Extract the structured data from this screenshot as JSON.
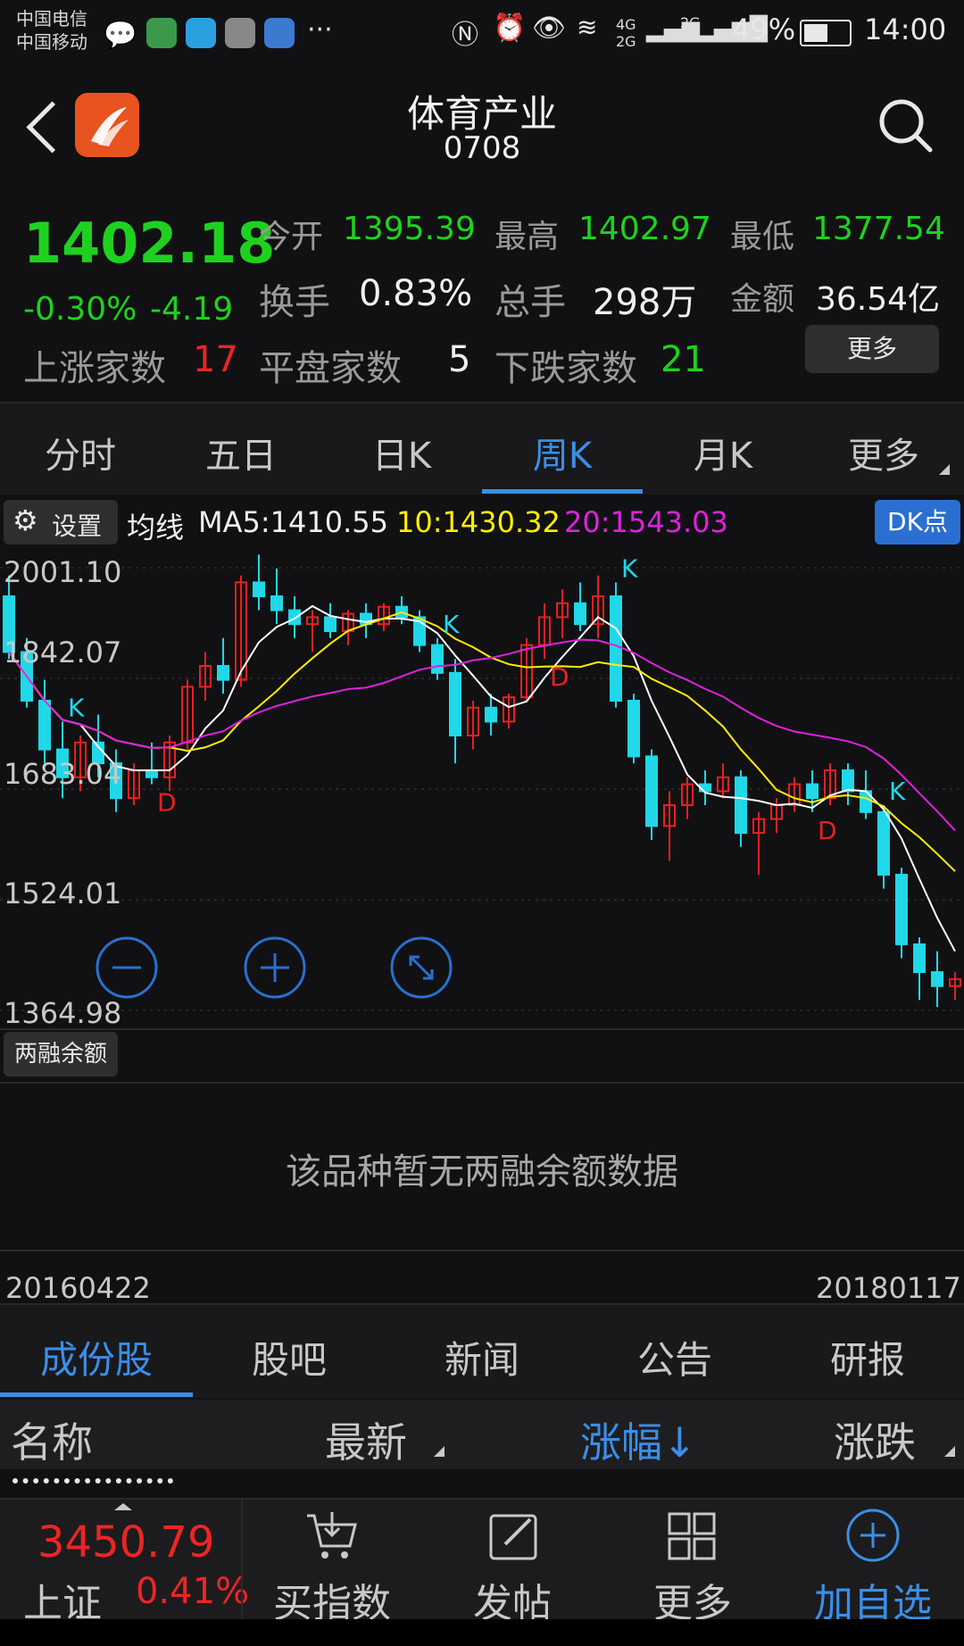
{
  "status_bar": {
    "carrier1": "中国电信",
    "carrier2": "中国移动",
    "network1": "4G 2G",
    "network2": "2G",
    "battery": "49%",
    "time": "14:00",
    "more": "···"
  },
  "header": {
    "title": "体育产业",
    "code": "0708"
  },
  "quote": {
    "price": "1402.18",
    "change_pct": "-0.30%",
    "change": "-4.19",
    "open_label": "今开",
    "open": "1395.39",
    "high_label": "最高",
    "high": "1402.97",
    "low_label": "最低",
    "low": "1377.54",
    "turnover_label": "换手",
    "turnover": "0.83%",
    "volume_label": "总手",
    "volume": "298万",
    "amount_label": "金额",
    "amount": "36.54亿",
    "up_label": "上涨家数",
    "up": "17",
    "flat_label": "平盘家数",
    "flat": "5",
    "down_label": "下跌家数",
    "down": "21",
    "more_label": "更多"
  },
  "period_tabs": [
    "分时",
    "五日",
    "日K",
    "周K",
    "月K",
    "更多"
  ],
  "period_active": 3,
  "ma": {
    "settings_label": "设置",
    "label": "均线",
    "ma5": "MA5:1410.55",
    "ma10": "10:1430.32",
    "ma20": "20:1543.03",
    "dk_label": "DK点",
    "colors": {
      "ma5": "#ffffff",
      "ma10": "#ffee00",
      "ma20": "#e020e0",
      "up": "#e82020",
      "down": "#20d8e8",
      "k_marker": "#20d8e8",
      "d_marker": "#e82020"
    }
  },
  "chart_data": {
    "type": "candlestick",
    "y_ticks": [
      "2001.10",
      "1842.07",
      "1683.04",
      "1524.01",
      "1364.98"
    ],
    "ylim": [
      1364.98,
      2001.1
    ],
    "x_start": "20160422",
    "x_end": "20180117",
    "markers": [
      "K",
      "D",
      "K",
      "D",
      "K",
      "D",
      "K"
    ],
    "candles": [
      [
        1960,
        1990,
        1870,
        1880
      ],
      [
        1880,
        1900,
        1800,
        1810
      ],
      [
        1810,
        1840,
        1720,
        1740
      ],
      [
        1740,
        1780,
        1670,
        1700
      ],
      [
        1700,
        1760,
        1680,
        1750
      ],
      [
        1750,
        1790,
        1700,
        1720
      ],
      [
        1720,
        1740,
        1650,
        1670
      ],
      [
        1670,
        1720,
        1660,
        1710
      ],
      [
        1710,
        1750,
        1690,
        1700
      ],
      [
        1700,
        1760,
        1680,
        1750
      ],
      [
        1750,
        1840,
        1740,
        1830
      ],
      [
        1830,
        1880,
        1810,
        1860
      ],
      [
        1860,
        1900,
        1820,
        1840
      ],
      [
        1840,
        1990,
        1830,
        1980
      ],
      [
        1980,
        2020,
        1940,
        1960
      ],
      [
        1960,
        2000,
        1920,
        1940
      ],
      [
        1940,
        1960,
        1900,
        1920
      ],
      [
        1920,
        1940,
        1880,
        1930
      ],
      [
        1930,
        1950,
        1900,
        1910
      ],
      [
        1910,
        1940,
        1890,
        1935
      ],
      [
        1935,
        1950,
        1900,
        1920
      ],
      [
        1920,
        1950,
        1910,
        1945
      ],
      [
        1945,
        1960,
        1920,
        1930
      ],
      [
        1930,
        1940,
        1880,
        1890
      ],
      [
        1890,
        1900,
        1840,
        1850
      ],
      [
        1850,
        1870,
        1720,
        1760
      ],
      [
        1760,
        1810,
        1740,
        1800
      ],
      [
        1800,
        1820,
        1760,
        1780
      ],
      [
        1780,
        1820,
        1770,
        1815
      ],
      [
        1815,
        1900,
        1810,
        1890
      ],
      [
        1890,
        1950,
        1870,
        1930
      ],
      [
        1930,
        1970,
        1900,
        1950
      ],
      [
        1950,
        1980,
        1910,
        1920
      ],
      [
        1920,
        1990,
        1900,
        1960
      ],
      [
        1960,
        1980,
        1800,
        1810
      ],
      [
        1810,
        1820,
        1720,
        1730
      ],
      [
        1730,
        1740,
        1610,
        1630
      ],
      [
        1630,
        1680,
        1580,
        1660
      ],
      [
        1660,
        1700,
        1640,
        1690
      ],
      [
        1690,
        1710,
        1660,
        1680
      ],
      [
        1680,
        1720,
        1670,
        1700
      ],
      [
        1700,
        1710,
        1600,
        1620
      ],
      [
        1620,
        1650,
        1560,
        1640
      ],
      [
        1640,
        1670,
        1620,
        1660
      ],
      [
        1660,
        1700,
        1650,
        1690
      ],
      [
        1690,
        1710,
        1650,
        1670
      ],
      [
        1670,
        1720,
        1660,
        1710
      ],
      [
        1710,
        1720,
        1660,
        1680
      ],
      [
        1680,
        1710,
        1640,
        1650
      ],
      [
        1650,
        1660,
        1540,
        1560
      ],
      [
        1560,
        1570,
        1440,
        1460
      ],
      [
        1460,
        1470,
        1380,
        1420
      ],
      [
        1420,
        1450,
        1370,
        1400
      ],
      [
        1400,
        1420,
        1380,
        1410
      ]
    ]
  },
  "margin": {
    "label": "两融余额",
    "no_data": "该品种暂无两融余额数据"
  },
  "section_tabs": [
    "成份股",
    "股吧",
    "新闻",
    "公告",
    "研报"
  ],
  "section_active": 0,
  "table_header": {
    "name": "名称",
    "latest": "最新",
    "change_pct": "涨幅↓",
    "change": "涨跌"
  },
  "bottom_bar": {
    "index_value": "3450.79",
    "index_name": "上证",
    "index_change": "0.41%",
    "buy_index": "买指数",
    "post": "发帖",
    "more": "更多",
    "add_watch": "加自选"
  }
}
